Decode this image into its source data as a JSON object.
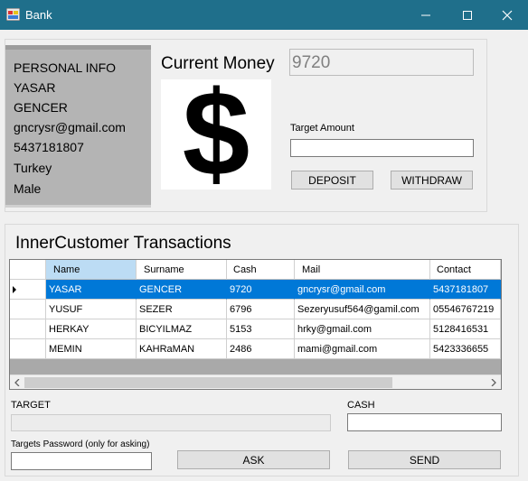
{
  "window": {
    "title": "Bank"
  },
  "personal": {
    "lines": [
      "PERSONAL INFO",
      "YASAR",
      "GENCER",
      "gncrysr@gmail.com",
      "5437181807",
      "Turkey",
      "Male"
    ]
  },
  "money": {
    "label": "Current Money",
    "value": "9720"
  },
  "transfer_top": {
    "target_amount_label": "Target Amount",
    "target_amount_value": "",
    "deposit_label": "DEPOSIT",
    "withdraw_label": "WITHDRAW"
  },
  "transactions": {
    "title": "InnerCustomer Transactions",
    "columns": [
      "Name",
      "Surname",
      "Cash",
      "Mail",
      "Contact"
    ],
    "rows": [
      [
        "YASAR",
        "GENCER",
        "9720",
        "gncrysr@gmail.com",
        "5437181807"
      ],
      [
        "YUSUF",
        "SEZER",
        "6796",
        "Sezeryusuf564@gamil.com",
        "05546767219"
      ],
      [
        "HERKAY",
        "BICYILMAZ",
        "5153",
        "hrky@gmail.com",
        "5128416531"
      ],
      [
        "MEMIN",
        "KAHRaMAN",
        "2486",
        "mami@gmail.com",
        "5423336655"
      ]
    ],
    "selected_row": 0
  },
  "bottom_form": {
    "target_label": "TARGET",
    "target_value": "",
    "cash_label": "CASH",
    "cash_value": "",
    "password_label": "Targets Password (only for asking)",
    "password_value": "",
    "ask_label": "ASK",
    "send_label": "SEND"
  },
  "colors": {
    "titlebar": "#1f6f8b",
    "selection": "#0078d7",
    "personal_panel": "#b4b4b4"
  }
}
